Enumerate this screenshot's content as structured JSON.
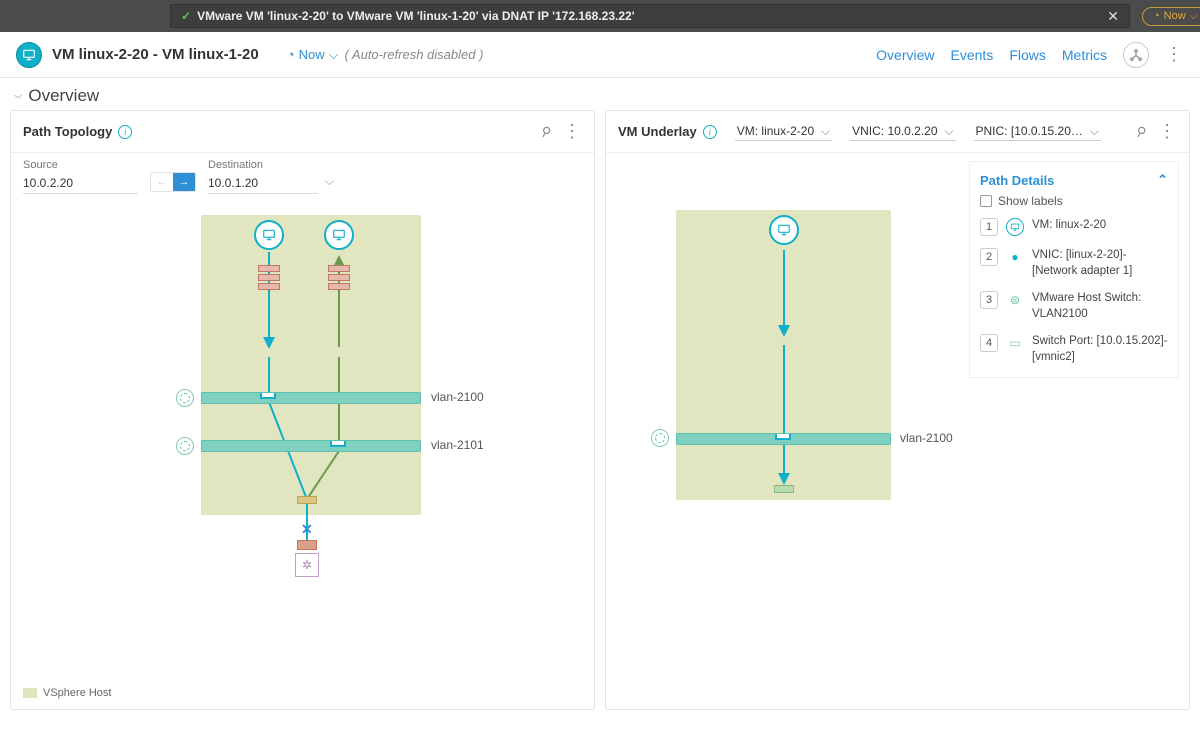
{
  "topbar": {
    "breadcrumb": "VMware VM 'linux-2-20' to VMware VM 'linux-1-20' via DNAT IP '172.168.23.22'",
    "now": "Now"
  },
  "subheader": {
    "title": "VM linux-2-20 - VM linux-1-20",
    "time": "Now",
    "auto_refresh": "( Auto-refresh  disabled )",
    "nav": {
      "overview": "Overview",
      "events": "Events",
      "flows": "Flows",
      "metrics": "Metrics"
    }
  },
  "overview_label": "Overview",
  "path_topology": {
    "title": "Path Topology",
    "source_label": "Source",
    "source_value": "10.0.2.20",
    "destination_label": "Destination",
    "destination_value": "10.0.1.20",
    "vlans": {
      "a": "vlan-2100",
      "b": "vlan-2101"
    },
    "legend": "VSphere Host"
  },
  "underlay": {
    "title": "VM Underlay",
    "vm_sel": "VM: linux-2-20",
    "vnic_sel": "VNIC: 10.0.2.20",
    "pnic_sel": "PNIC: [10.0.15.20…",
    "vlan": "vlan-2100",
    "path_details": {
      "title": "Path Details",
      "show_labels": "Show labels",
      "steps": [
        {
          "n": "1",
          "label": "VM: linux-2-20"
        },
        {
          "n": "2",
          "label": "VNIC: [linux-2-20]-[Network adapter 1]"
        },
        {
          "n": "3",
          "label": "VMware Host Switch: VLAN2100"
        },
        {
          "n": "4",
          "label": "Switch Port: [10.0.15.202]-[vmnic2]"
        }
      ]
    }
  }
}
